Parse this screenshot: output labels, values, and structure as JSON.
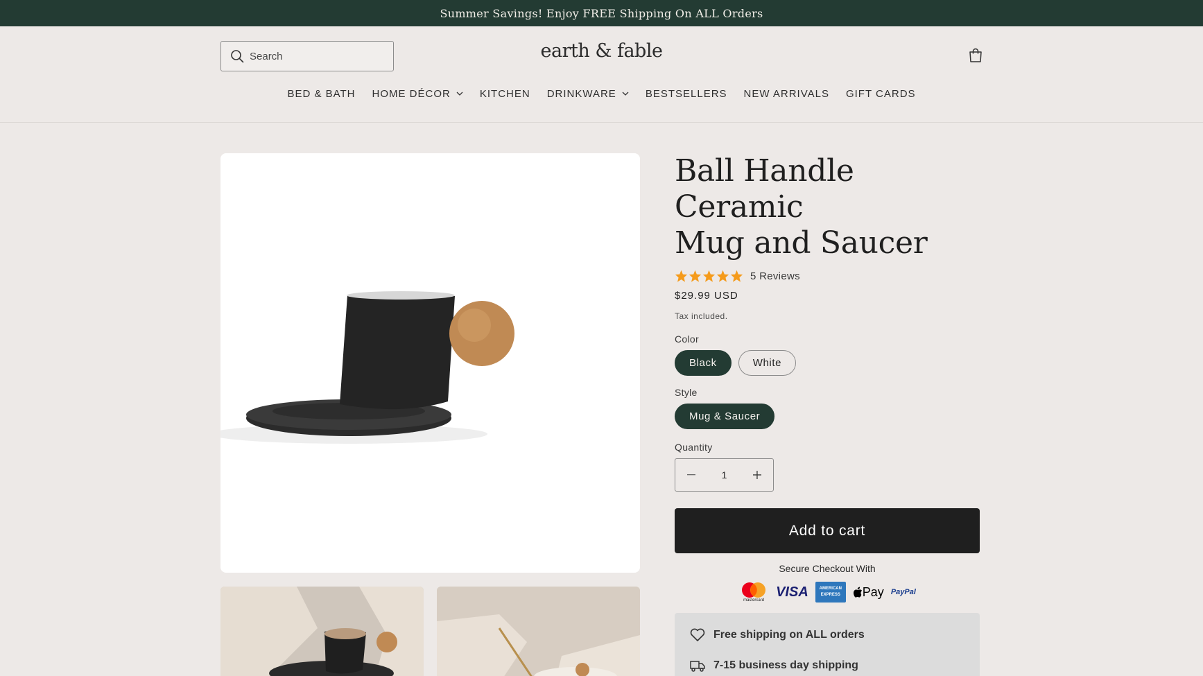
{
  "announcement": "Summer Savings! Enjoy FREE Shipping On ALL Orders",
  "header": {
    "search_placeholder": "Search",
    "logo": "earth & fable",
    "cart_icon": "cart-icon"
  },
  "nav": {
    "items": [
      {
        "label": "BED & BATH",
        "dropdown": false
      },
      {
        "label": "HOME DÉCOR",
        "dropdown": true
      },
      {
        "label": "KITCHEN",
        "dropdown": false
      },
      {
        "label": "DRINKWARE",
        "dropdown": true
      },
      {
        "label": "BESTSELLERS",
        "dropdown": false
      },
      {
        "label": "NEW ARRIVALS",
        "dropdown": false
      },
      {
        "label": "GIFT CARDS",
        "dropdown": false
      }
    ]
  },
  "product": {
    "title_line1": "Ball Handle Ceramic",
    "title_line2": "Mug and Saucer",
    "rating": 5,
    "reviews": "5 Reviews",
    "price": "$29.99 USD",
    "tax_note": "Tax included.",
    "color_label": "Color",
    "colors": [
      "Black",
      "White"
    ],
    "selected_color": "Black",
    "style_label": "Style",
    "styles": [
      "Mug & Saucer"
    ],
    "selected_style": "Mug & Saucer",
    "quantity_label": "Quantity",
    "quantity": "1",
    "add_to_cart": "Add to cart",
    "secure_checkout": "Secure Checkout With",
    "payment_methods": [
      "mastercard",
      "VISA",
      "AMERICAN EXPRESS",
      "Pay",
      "PayPal"
    ]
  },
  "benefits": [
    {
      "icon": "heart-icon",
      "text": "Free shipping on ALL orders"
    },
    {
      "icon": "truck-icon",
      "text": "7-15 business day shipping"
    }
  ],
  "colors": {
    "announce_bg": "#233b33",
    "selected_pill": "#233b33",
    "star": "#f59b1b",
    "button": "#1f1f1f"
  }
}
